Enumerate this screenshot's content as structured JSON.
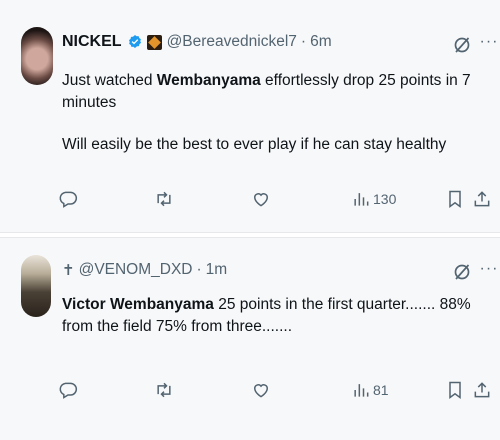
{
  "tweets": [
    {
      "author_name": "NICKEL",
      "handle": "@Bereavednickel7",
      "separator": "·",
      "time": "6m",
      "text_line1_prefix": "Just watched ",
      "text_line1_bold": "Wembanyama",
      "text_line1_suffix": " effortlessly drop 25 points in 7 minutes",
      "text_line2": "Will easily be the best to ever play if he can stay healthy",
      "views": "130",
      "more_label": "···"
    },
    {
      "cross": "✝",
      "handle": "@VENOM_DXD",
      "separator": "·",
      "time": "1m",
      "text_bold": "Victor Wembanyama",
      "text_suffix": " 25 points in the first quarter....... 88% from the field 75% from three.......",
      "views": "81",
      "more_label": "···"
    }
  ],
  "icons": {
    "verified": "verified-badge-icon",
    "grok": "grok-icon",
    "reply": "reply-icon",
    "repost": "repost-icon",
    "like": "heart-icon",
    "views": "views-chart-icon",
    "bookmark": "bookmark-icon",
    "share": "share-icon"
  },
  "colors": {
    "background": "#f7f8f9",
    "text": "#0f1419",
    "muted": "#536471",
    "verified": "#1d9bf0"
  }
}
